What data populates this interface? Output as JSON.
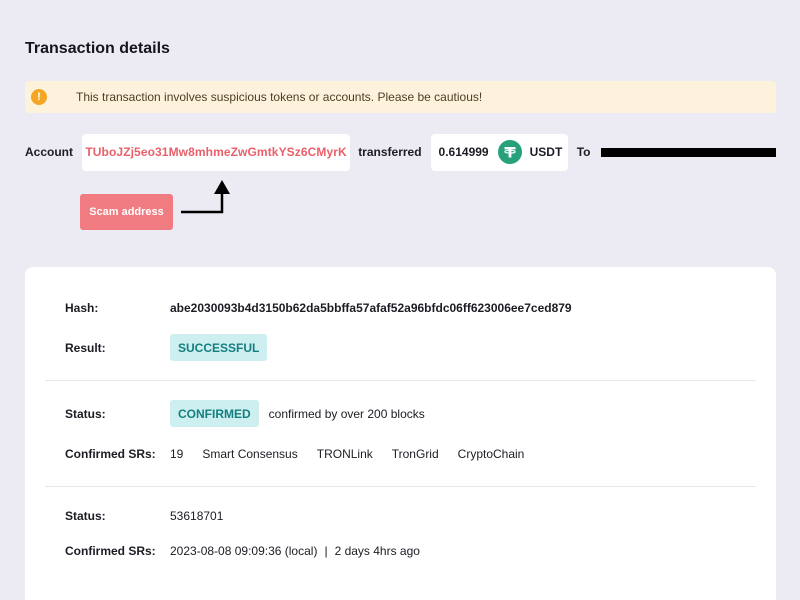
{
  "page": {
    "title": "Transaction details"
  },
  "warning": {
    "icon": "exclamation-icon",
    "text": "This transaction involves suspicious tokens or accounts. Please be cautious!",
    "bg_color": "#fdf2dc",
    "icon_color": "#f5a623"
  },
  "transfer": {
    "account_label": "Account",
    "account_address": "TUboJZj5eo31Mw8mhmeZwGmtkYSz6CMyrK",
    "transferred_label": "transferred",
    "amount": "0.614999",
    "token_icon": "tether-icon",
    "token": "USDT",
    "to_label": "To",
    "address_color": "#e8606a",
    "token_color": "#26a17b"
  },
  "scam": {
    "label": "Scam address",
    "color": "#f07c82"
  },
  "details": {
    "hash_label": "Hash:",
    "hash": "abe2030093b4d3150b62da5bbffa57afaf52a96bfdc06ff623006ee7ced879",
    "result_label": "Result:",
    "result": "SUCCESSFUL",
    "status_label": "Status:",
    "status": "CONFIRMED",
    "status_note": "confirmed by over 200 blocks",
    "confirmed_srs_label": "Confirmed SRs:",
    "confirmed_srs": [
      "19",
      "Smart Consensus",
      "TRONLink",
      "TronGrid",
      "CryptoChain"
    ],
    "block_status_label": "Status:",
    "block_number": "53618701",
    "time_label": "Confirmed SRs:",
    "timestamp": "2023-08-08 09:09:36 (local)",
    "separator": "|",
    "relative_time": "2 days 4hrs ago",
    "pill_bg": "#cdeff0",
    "pill_text": "#147e80"
  }
}
